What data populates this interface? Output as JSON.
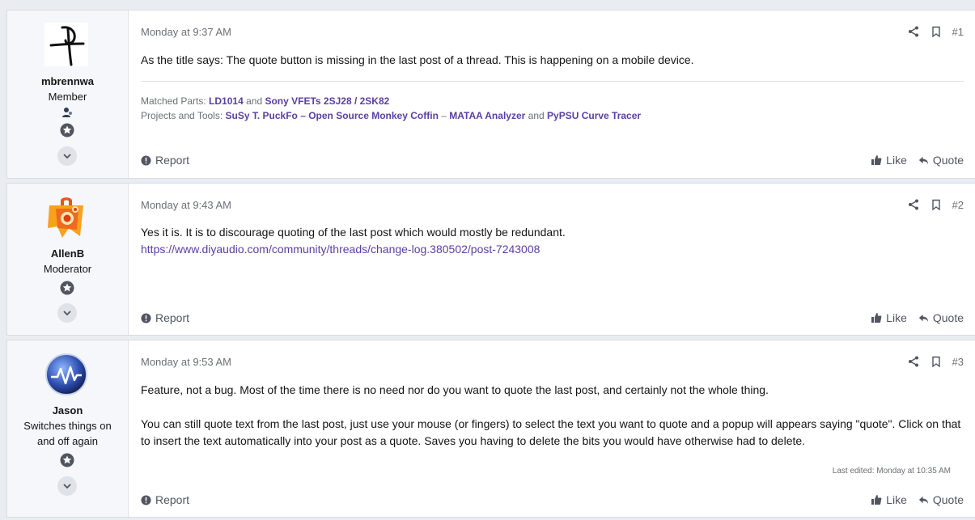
{
  "colors": {
    "link": "#5b3fa0",
    "muted": "#6b6f75",
    "background": "#e9ecf0"
  },
  "posts": [
    {
      "username": "mbrennwa",
      "user_title": "Member",
      "time": "Monday at 9:37 AM",
      "number": "#1",
      "text": "As the title says: The quote button is missing in the last post of a thread. This is happening on a mobile device.",
      "sig": {
        "line1_prefix": "Matched Parts:",
        "line1_link1": "LD1014",
        "line1_and": "and",
        "line1_link2": "Sony VFETs 2SJ28 / 2SK82",
        "line2_prefix": "Projects and Tools:",
        "line2_link1": "SuSy T. PuckFo – Open Source Monkey Coffin",
        "line2_dash": "–",
        "line2_link2": "MATAA Analyzer",
        "line2_and": "and",
        "line2_link3": "PyPSU Curve Tracer"
      },
      "report": "Report",
      "like": "Like",
      "quote": "Quote"
    },
    {
      "username": "AllenB",
      "user_title": "Moderator",
      "time": "Monday at 9:43 AM",
      "number": "#2",
      "text": "Yes it is. It is to discourage quoting of the last post which would mostly be redundant.",
      "link": "https://www.diyaudio.com/community/threads/change-log.380502/post-7243008",
      "report": "Report",
      "like": "Like",
      "quote": "Quote"
    },
    {
      "username": "Jason",
      "user_title_1": "Switches things on",
      "user_title_2": "and off again",
      "time": "Monday at 9:53 AM",
      "number": "#3",
      "text1": "Feature, not a bug. Most of the time there is no need nor do you want to quote the last post, and certainly not the whole thing.",
      "text2": "You can still quote text from the last post, just use your mouse (or fingers) to select the text you want to quote and a popup will appears saying \"quote\". Click on that to insert the text automatically into your post as a quote. Saves you having to delete the bits you would have otherwise had to delete.",
      "edited": "Last edited: Monday at 10:35 AM",
      "report": "Report",
      "like": "Like",
      "quote": "Quote"
    }
  ]
}
